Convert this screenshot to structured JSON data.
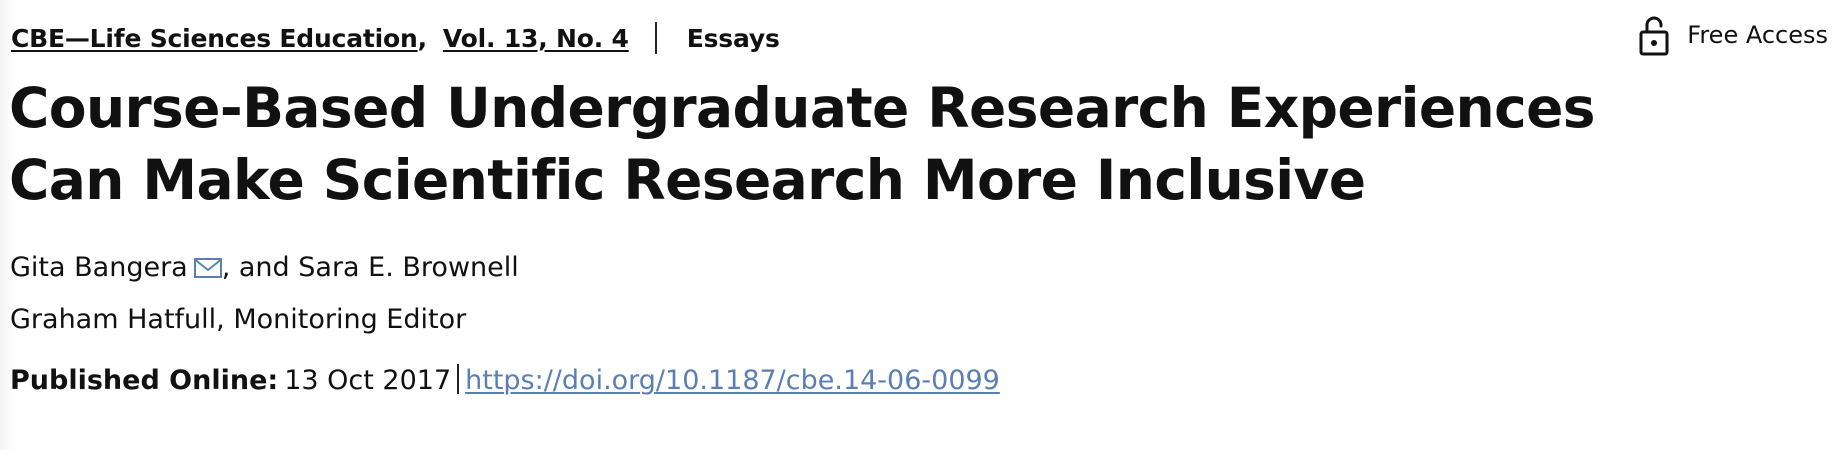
{
  "header": {
    "journal": "CBE—Life Sciences Education",
    "issue": "Vol. 13, No. 4",
    "section": "Essays",
    "access_label": "Free Access",
    "access_icon": "unlocked-padlock-icon"
  },
  "article": {
    "title": "Course-Based Undergraduate Research Experiences Can Make Scientific Research More Inclusive",
    "authors": {
      "first": "Gita Bangera",
      "first_icon": "envelope-icon",
      "rest": ", and Sara E. Brownell"
    },
    "editor": "Graham Hatfull, Monitoring Editor",
    "published_label": "Published Online:",
    "published_date": "13 Oct 2017",
    "doi": "https://doi.org/10.1187/cbe.14-06-0099"
  },
  "colors": {
    "text": "#111111",
    "link": "#5b7fb4",
    "icon": "#5b7fb4"
  }
}
